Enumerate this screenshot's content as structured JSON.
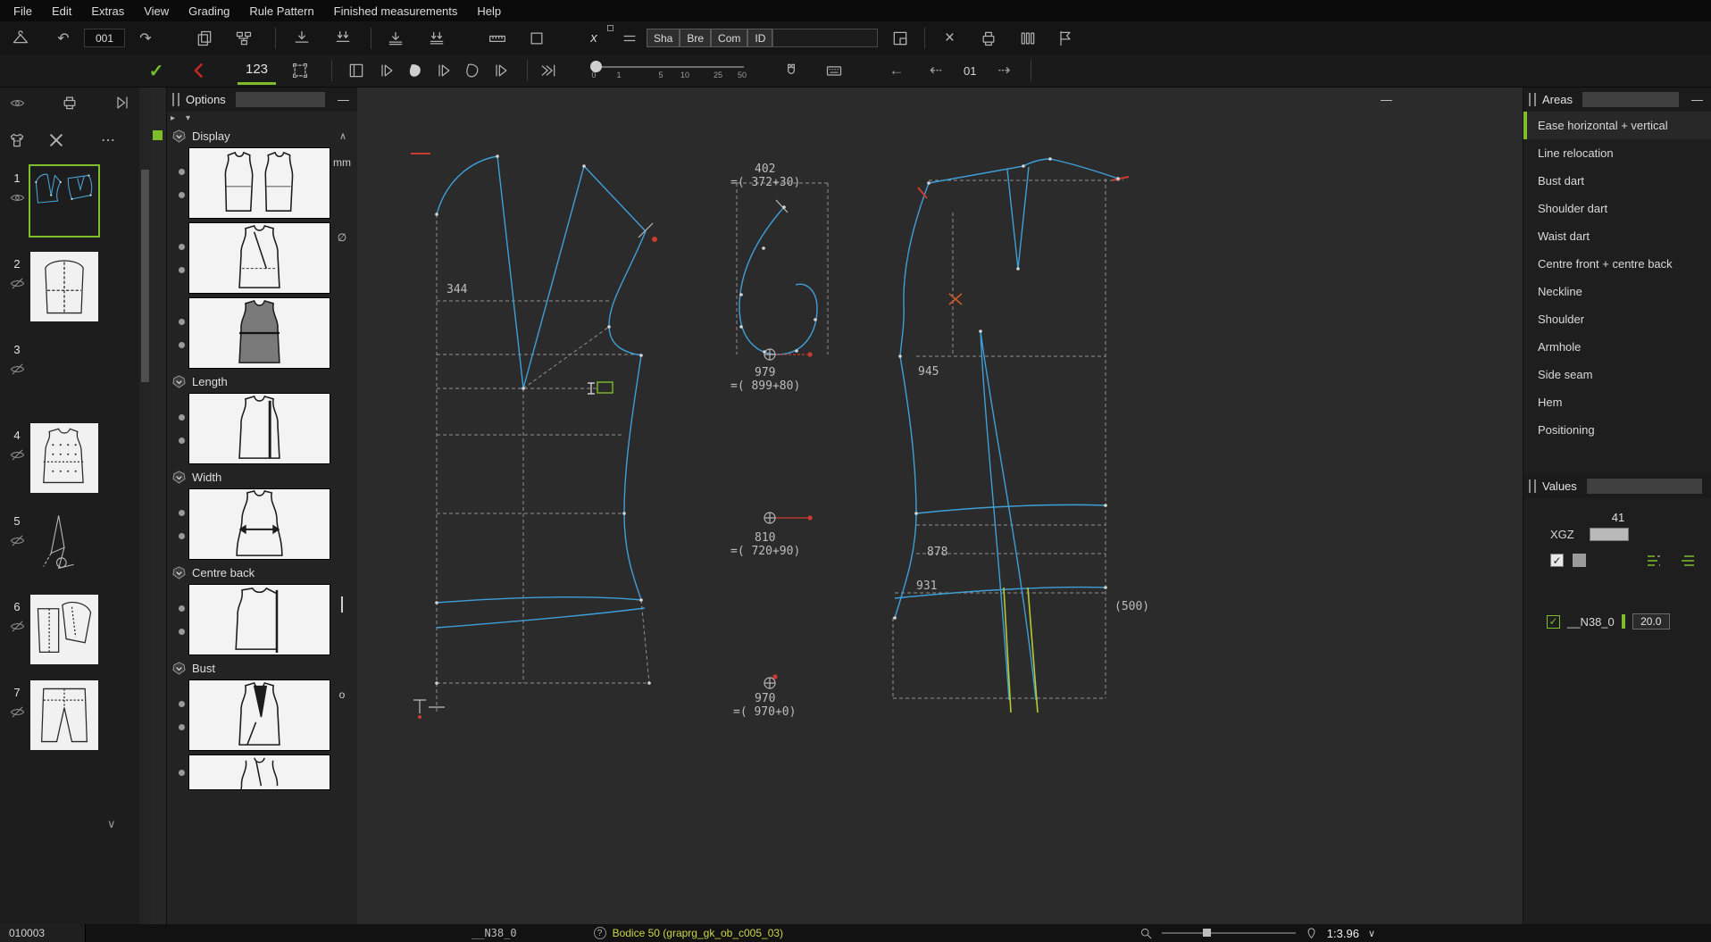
{
  "menubar": {
    "items": [
      "File",
      "Edit",
      "Extras",
      "View",
      "Grading",
      "Rule Pattern",
      "Finished measurements",
      "Help"
    ]
  },
  "toolbar": {
    "counter_value": "001",
    "x_label": "x",
    "buttons": {
      "sha": "Sha",
      "bre": "Bre",
      "com": "Com",
      "id": "ID"
    }
  },
  "toolbar2": {
    "tab_label": "123",
    "ticks": [
      "0",
      "1",
      "5",
      "10",
      "25",
      "50"
    ],
    "step_value": "01"
  },
  "sidebar": {
    "items": [
      {
        "num": "1"
      },
      {
        "num": "2"
      },
      {
        "num": "3"
      },
      {
        "num": "4"
      },
      {
        "num": "5"
      },
      {
        "num": "6"
      },
      {
        "num": "7"
      }
    ]
  },
  "options": {
    "title": "Options",
    "sections": {
      "display": "Display",
      "length": "Length",
      "width": "Width",
      "centre_back": "Centre back",
      "bust": "Bust"
    },
    "badges": {
      "mm": "mm",
      "o": "o"
    }
  },
  "canvas": {
    "labels": {
      "front_width": "344",
      "m402": "402",
      "m402_formula": "=( 372+30)",
      "m979": "979",
      "m979_formula": "=( 899+80)",
      "m945": "945",
      "m810": "810",
      "m810_formula": "=( 720+90)",
      "m878": "878",
      "m931": "931",
      "m500": "(500)",
      "m970": "970",
      "m970_formula": "=( 970+0)"
    }
  },
  "areas": {
    "title": "Areas",
    "items": [
      "Ease horizontal + vertical",
      "Line relocation",
      "Bust dart",
      "Shoulder dart",
      "Waist dart",
      "Centre front + centre back",
      "Neckline",
      "Shoulder",
      "Armhole",
      "Side seam",
      "Hem",
      "Positioning"
    ]
  },
  "values": {
    "title": "Values",
    "value": "41",
    "xgz_label": "XGZ",
    "row": {
      "name": "__N38_0",
      "value": "20.0"
    }
  },
  "statusbar": {
    "record_id": "010003",
    "measure_name": "__N38_0",
    "document": "Bodice 50 (graprg_gk_ob_c005_03)",
    "zoom_ratio": "1:3.96"
  },
  "icons": {
    "undo": "↶",
    "redo": "↷",
    "close": "×",
    "dots": "⋯",
    "chevron_up": "∧",
    "chevron_down": "∨",
    "caret_right": "▸",
    "caret_down": "▾",
    "arrow_left": "←",
    "arrow_left_dashed": "⇠",
    "arrow_right_dashed": "⇢",
    "check": "✓",
    "minimize": "—",
    "question": "?",
    "slash": "∅"
  }
}
